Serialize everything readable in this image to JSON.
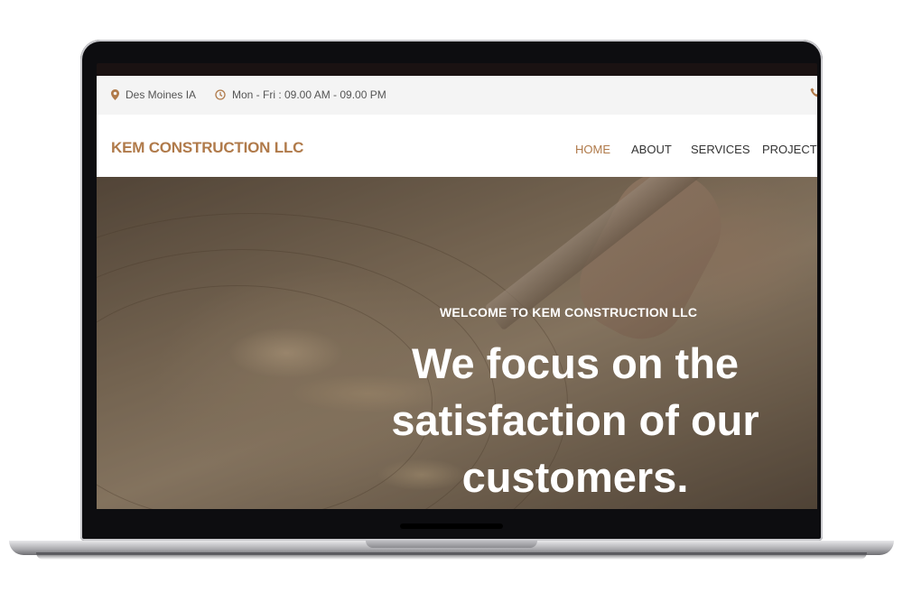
{
  "topbar": {
    "location": "Des Moines IA",
    "hours": "Mon - Fri : 09.00 AM - 09.00 PM",
    "accent_color": "#b07a4a"
  },
  "navbar": {
    "brand": "KEM CONSTRUCTION LLC",
    "items": [
      {
        "label": "HOME",
        "active": true
      },
      {
        "label": "ABOUT",
        "active": false
      },
      {
        "label": "SERVICES",
        "active": false
      },
      {
        "label": "PROJECT",
        "active": false
      }
    ]
  },
  "hero": {
    "subtitle": "WELCOME TO KEM CONSTRUCTION LLC",
    "title": "We focus on the satisfaction of our customers."
  },
  "icons": {
    "location": "map-pin-icon",
    "hours": "clock-icon",
    "phone": "phone-icon"
  }
}
